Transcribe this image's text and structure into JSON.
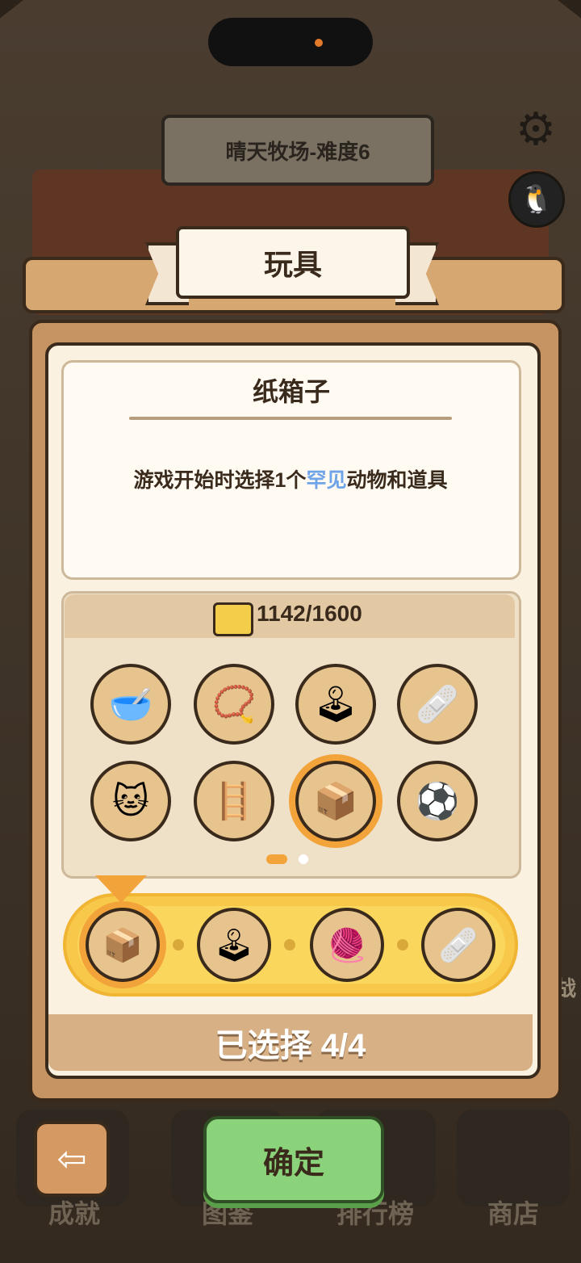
{
  "header": {
    "sign_text": "晴天牧场-难度6"
  },
  "panel": {
    "title": "玩具",
    "item_name": "纸箱子",
    "desc_before": "游戏开始时选择1个",
    "desc_highlight": "罕见",
    "desc_after": "动物和道具",
    "count": "1142/1600",
    "selected_text": "已选择 4/4",
    "page_index": 1,
    "page_total": 2
  },
  "toys": [
    {
      "icon": "cat-bowl-icon",
      "glyph": "🥣",
      "selected": false
    },
    {
      "icon": "collar-icon",
      "glyph": "📿",
      "selected": false
    },
    {
      "icon": "joystick-icon",
      "glyph": "🕹",
      "selected": false
    },
    {
      "icon": "medkit-icon",
      "glyph": "🩹",
      "selected": false
    },
    {
      "icon": "cat-doll-icon",
      "glyph": "🐱",
      "selected": false
    },
    {
      "icon": "cat-tree-icon",
      "glyph": "🪜",
      "selected": false
    },
    {
      "icon": "cardboard-box-icon",
      "glyph": "📦",
      "selected": true
    },
    {
      "icon": "balls-icon",
      "glyph": "⚽",
      "selected": false
    }
  ],
  "slots": [
    {
      "icon": "cardboard-box-icon",
      "glyph": "📦",
      "active": true
    },
    {
      "icon": "joystick-icon",
      "glyph": "🕹",
      "active": false
    },
    {
      "icon": "yarn-ring-icon",
      "glyph": "🧶",
      "active": false
    },
    {
      "icon": "medkit-icon",
      "glyph": "🩹",
      "active": false
    }
  ],
  "nav": {
    "achievements": "成就",
    "catalog": "图鉴",
    "ranking": "排行榜",
    "shop": "商店",
    "confirm": "确定",
    "side_label": "战"
  },
  "icons": {
    "gear": "⚙",
    "avatar": "🐧",
    "back": "⇦"
  }
}
